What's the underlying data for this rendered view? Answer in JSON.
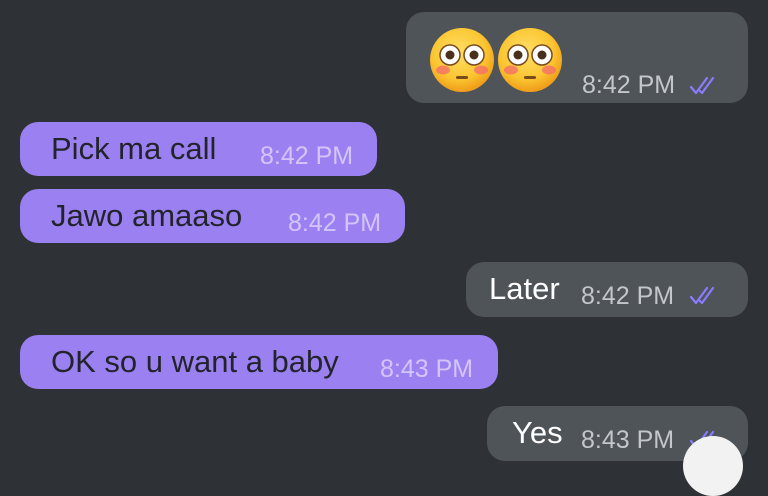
{
  "colors": {
    "background": "#2e3136",
    "outgoing_bubble": "#4f5459",
    "incoming_bubble": "#9b80f2",
    "read_ticks": "#8b7bff"
  },
  "messages": [
    {
      "direction": "outgoing",
      "content": "emoji",
      "emoji_icons": [
        "flushed-face-emoji",
        "flushed-face-emoji"
      ],
      "time": "8:42 PM",
      "status": "read"
    },
    {
      "direction": "incoming",
      "text": "Pick ma call",
      "time": "8:42 PM"
    },
    {
      "direction": "incoming",
      "text": "Jawo amaaso",
      "time": "8:42 PM"
    },
    {
      "direction": "outgoing",
      "text": "Later",
      "time": "8:42 PM",
      "status": "read"
    },
    {
      "direction": "incoming",
      "text": "OK so u want a baby",
      "time": "8:43 PM"
    },
    {
      "direction": "outgoing",
      "text": "Yes",
      "time": "8:43 PM",
      "status": "read"
    }
  ]
}
